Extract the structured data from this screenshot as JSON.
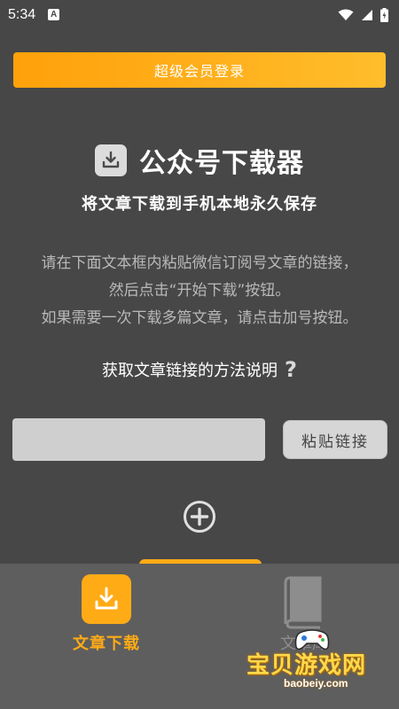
{
  "status_bar": {
    "time": "5:34",
    "notification_icon": "A"
  },
  "vip_button": {
    "label": "超级会员登录"
  },
  "header": {
    "title": "公众号下载器",
    "subtitle": "将文章下载到手机本地永久保存"
  },
  "instructions": {
    "line1": "请在下面文本框内粘贴微信订阅号文章的链接，",
    "line2": "然后点击“开始下载”按钮。",
    "line3": "如果需要一次下载多篇文章，请点击加号按钮。"
  },
  "help": {
    "label": "获取文章链接的方法说明",
    "icon": "?"
  },
  "link_input": {
    "value": "",
    "placeholder": ""
  },
  "paste_button": {
    "label": "粘贴链接"
  },
  "bottom_nav": {
    "download_tab": {
      "label": "文章下载",
      "active": true
    },
    "library_tab": {
      "label": "文章库"
    }
  },
  "watermark": {
    "text": "宝贝游戏网",
    "url": "baobeiy.com"
  },
  "colors": {
    "background": "#474747",
    "accent": "#ffab16",
    "nav_background": "#5e5e5e"
  }
}
